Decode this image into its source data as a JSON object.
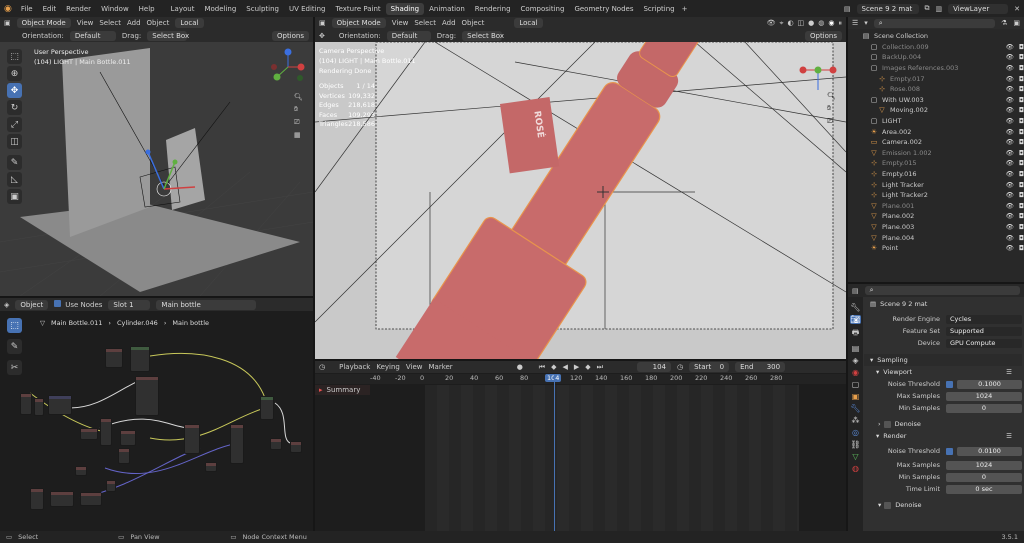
{
  "top_menu": [
    "File",
    "Edit",
    "Render",
    "Window",
    "Help"
  ],
  "workspaces": [
    "Layout",
    "Modeling",
    "Sculpting",
    "UV Editing",
    "Texture Paint",
    "Shading",
    "Animation",
    "Rendering",
    "Compositing",
    "Geometry Nodes",
    "Scripting"
  ],
  "active_workspace": "Shading",
  "scene_name": "Scene 9 2 mat",
  "view_layer": "ViewLayer",
  "left_viewport": {
    "mode": "Object Mode",
    "menus": [
      "View",
      "Select",
      "Add",
      "Object"
    ],
    "transform": "Local",
    "orientation_label": "Orientation:",
    "orientation": "Default",
    "drag_label": "Drag:",
    "drag": "Select Box",
    "options": "Options",
    "overlay_title": "User Perspective",
    "overlay_sub": "(104) LIGHT | Main Bottle.011"
  },
  "camera_viewport": {
    "mode": "Object Mode",
    "menus": [
      "View",
      "Select",
      "Add",
      "Object"
    ],
    "transform": "Local",
    "orientation_label": "Orientation:",
    "orientation": "Default",
    "drag_label": "Drag:",
    "drag": "Select Box",
    "options": "Options",
    "overlay_title": "Camera Perspective",
    "overlay_sub": "(104) LIGHT | Main Bottle.011",
    "overlay_status": "Rendering Done",
    "stats": [
      {
        "k": "Objects",
        "v": "1 / 14"
      },
      {
        "k": "Vertices",
        "v": "109,332"
      },
      {
        "k": "Edges",
        "v": "218,618"
      },
      {
        "k": "Faces",
        "v": "109,293"
      },
      {
        "k": "Triangles",
        "v": "218,586"
      }
    ],
    "label_text": "ROSÉ"
  },
  "node_editor": {
    "type": "Object",
    "use_nodes": "Use Nodes",
    "slot": "Slot 1",
    "material": "Main bottle",
    "breadcrumb": [
      "Main Bottle.011",
      "Cylinder.046",
      "Main bottle"
    ]
  },
  "outliner": {
    "search_placeholder": "",
    "root": "Scene Collection",
    "items": [
      {
        "name": "Collection.009",
        "indent": 1,
        "icon": "collection",
        "dim": true
      },
      {
        "name": "BackUp.004",
        "indent": 1,
        "icon": "collection",
        "dim": true
      },
      {
        "name": "Images References.003",
        "indent": 1,
        "icon": "collection",
        "dim": true
      },
      {
        "name": "Empty.017",
        "indent": 2,
        "icon": "empty",
        "dim": true
      },
      {
        "name": "Rose.008",
        "indent": 2,
        "icon": "empty",
        "dim": true
      },
      {
        "name": "With UW.003",
        "indent": 1,
        "icon": "collection",
        "dim": false
      },
      {
        "name": "Moving.002",
        "indent": 2,
        "icon": "object",
        "dim": false
      },
      {
        "name": "LIGHT",
        "indent": 1,
        "icon": "collection",
        "dim": false
      },
      {
        "name": "Area.002",
        "indent": 1,
        "icon": "light",
        "dim": false
      },
      {
        "name": "Camera.002",
        "indent": 1,
        "icon": "camera",
        "dim": false
      },
      {
        "name": "Emission 1.002",
        "indent": 1,
        "icon": "mesh",
        "dim": true
      },
      {
        "name": "Empty.015",
        "indent": 1,
        "icon": "empty",
        "dim": true
      },
      {
        "name": "Empty.016",
        "indent": 1,
        "icon": "empty",
        "dim": false
      },
      {
        "name": "Light Tracker",
        "indent": 1,
        "icon": "empty",
        "dim": false
      },
      {
        "name": "Light Tracker2",
        "indent": 1,
        "icon": "empty",
        "dim": false
      },
      {
        "name": "Plane.001",
        "indent": 1,
        "icon": "mesh",
        "dim": true
      },
      {
        "name": "Plane.002",
        "indent": 1,
        "icon": "mesh",
        "dim": false
      },
      {
        "name": "Plane.003",
        "indent": 1,
        "icon": "mesh",
        "dim": false
      },
      {
        "name": "Plane.004",
        "indent": 1,
        "icon": "mesh",
        "dim": false
      },
      {
        "name": "Point",
        "indent": 1,
        "icon": "light",
        "dim": false
      }
    ]
  },
  "properties": {
    "scene_title": "Scene 9 2 mat",
    "render_engine_label": "Render Engine",
    "render_engine": "Cycles",
    "feature_set_label": "Feature Set",
    "feature_set": "Supported",
    "device_label": "Device",
    "device": "GPU Compute",
    "sampling": "Sampling",
    "viewport": "Viewport",
    "vp_noise_label": "Noise Threshold",
    "vp_noise": "0.1000",
    "vp_max_label": "Max Samples",
    "vp_max": "1024",
    "vp_min_label": "Min Samples",
    "vp_min": "0",
    "denoise": "Denoise",
    "render": "Render",
    "r_noise_label": "Noise Threshold",
    "r_noise": "0.0100",
    "r_max_label": "Max Samples",
    "r_max": "1024",
    "r_min_label": "Min Samples",
    "r_min": "0",
    "time_limit_label": "Time Limit",
    "time_limit": "0 sec",
    "denoise2": "Denoise"
  },
  "timeline": {
    "menus": [
      "Playback",
      "Keying",
      "View",
      "Marker"
    ],
    "current_frame": "104",
    "start_label": "Start",
    "start": "0",
    "end_label": "End",
    "end": "300",
    "ruler": [
      "-40",
      "-20",
      "0",
      "20",
      "40",
      "60",
      "80",
      "104",
      "120",
      "140",
      "160",
      "180",
      "200",
      "220",
      "240",
      "260",
      "280"
    ],
    "summary": "Summary"
  },
  "status_bar": {
    "select": "Select",
    "pan": "Pan View",
    "context": "Node Context Menu",
    "version": "3.5.1"
  },
  "colors": {
    "accent": "#4772b3",
    "bottle": "#c86b6b",
    "playhead": "#4772b3",
    "active_ws": "#3d3d3d"
  }
}
